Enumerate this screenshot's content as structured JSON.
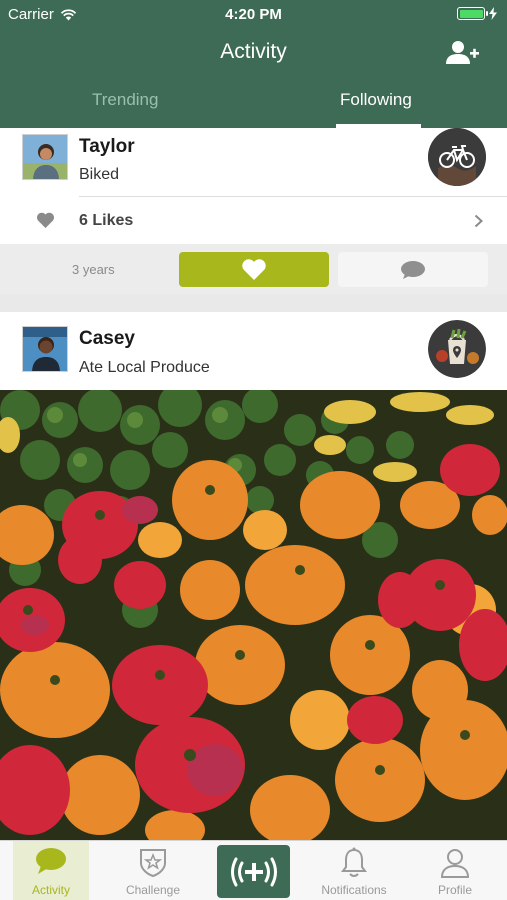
{
  "status_bar": {
    "carrier": "Carrier",
    "time": "4:20 PM"
  },
  "header": {
    "title": "Activity",
    "tabs": [
      {
        "label": "Trending",
        "selected": false
      },
      {
        "label": "Following",
        "selected": true
      }
    ]
  },
  "feed": [
    {
      "user": "Taylor",
      "activity": "Biked",
      "badge_icon": "bicycle-icon",
      "likes": "6 Likes",
      "time_ago": "3 years"
    },
    {
      "user": "Casey",
      "activity": "Ate Local Produce",
      "badge_icon": "produce-basket-icon",
      "photo": "tomatoes-photo"
    }
  ],
  "tabbar": {
    "items": [
      {
        "label": "Activity",
        "icon": "speech-bubble-icon",
        "selected": true
      },
      {
        "label": "Challenge",
        "icon": "star-shield-icon",
        "selected": false
      },
      {
        "label": "",
        "icon": "add-action-icon",
        "selected": false
      },
      {
        "label": "Notifications",
        "icon": "bell-icon",
        "selected": false
      },
      {
        "label": "Profile",
        "icon": "person-icon",
        "selected": false
      }
    ]
  },
  "colors": {
    "header_green": "#3e6b55",
    "accent_lime": "#a8b71c",
    "battery_green": "#4cd964"
  }
}
